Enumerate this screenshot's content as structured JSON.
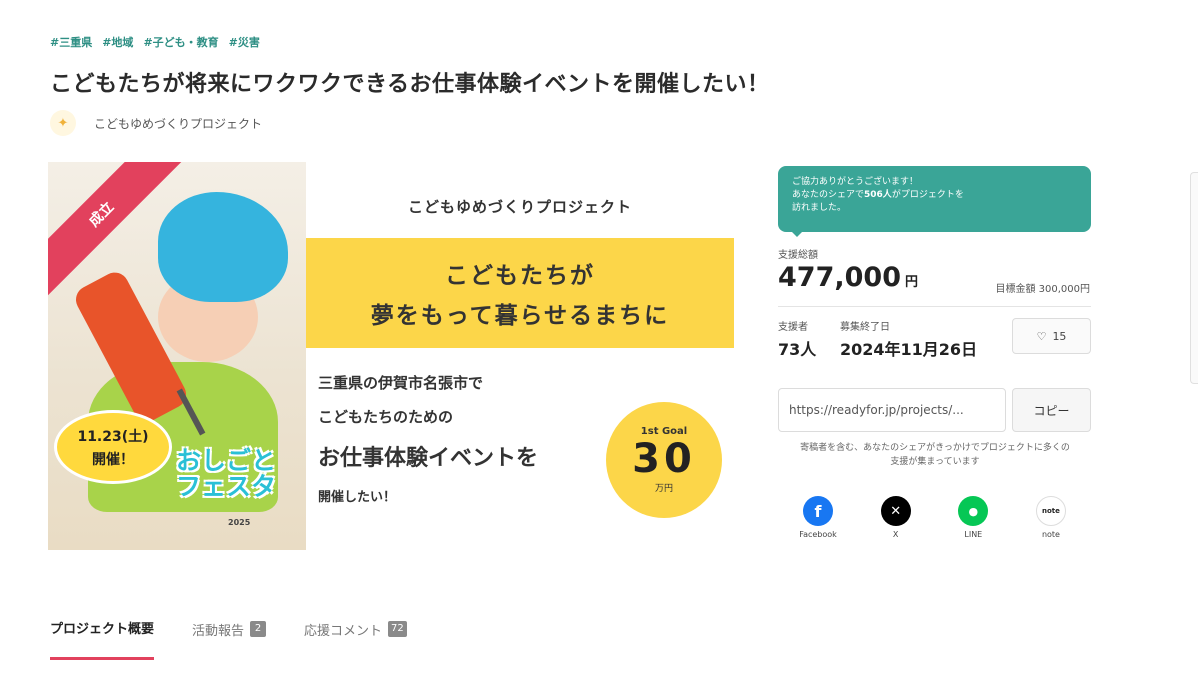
{
  "tags": [
    "#三重県",
    "#地域",
    "#子ども・教育",
    "#災害"
  ],
  "title": "こどもたちが将来にワクワクできるお仕事体験イベントを開催したい！",
  "owner": {
    "name": "こどもゆめづくりプロジェクト"
  },
  "hero": {
    "ribbon": "成立",
    "date_line1": "11.23(土)",
    "date_line2": "開催！",
    "logo_line1": "おしごと",
    "logo_line2": "フェスタ",
    "logo_year": "2025",
    "org": "こどもゆめづくりプロジェクト",
    "banner_line1": "こどもたちが",
    "banner_line2": "夢をもって暮らせるまちに",
    "text1": "三重県の伊賀市名張市で",
    "text2": "こどもたちのための",
    "text3": "お仕事体験イベントを",
    "text4": "開催したい！",
    "goal_label": "1st Goal",
    "goal_value": "30",
    "goal_unit": "万円"
  },
  "notice": {
    "line1": "ご協力ありがとうございます！",
    "line2_pre": "あなたのシェアで",
    "line2_bold": "506人",
    "line2_post": "がプロジェクトを",
    "line3": "訪れました。"
  },
  "funding": {
    "amount_label": "支援総額",
    "amount": "477,000",
    "amount_unit": "円",
    "target": "目標金額 300,000円",
    "supporters_label": "支援者",
    "supporters": "73人",
    "end_label": "募集終了日",
    "end_date": "2024年11月26日",
    "favorites": "15"
  },
  "share": {
    "url": "https://readyfor.jp/projects/...",
    "copy_label": "コピー",
    "note": "寄稿者を含む、あなたのシェアがきっかけでプロジェクトに多くの支援が集まっています",
    "items": [
      {
        "label": "Facebook",
        "icon": "facebook-icon",
        "color": "#1877f2",
        "glyph": "f"
      },
      {
        "label": "X",
        "icon": "x-icon",
        "color": "#000000",
        "glyph": "𝕏"
      },
      {
        "label": "LINE",
        "icon": "line-icon",
        "color": "#06c755",
        "glyph": "L"
      },
      {
        "label": "note",
        "icon": "note-icon",
        "color": "#ffffff",
        "glyph": "note"
      }
    ]
  },
  "tabs": [
    {
      "label": "プロジェクト概要",
      "count": null,
      "active": true
    },
    {
      "label": "活動報告",
      "count": "2",
      "active": false
    },
    {
      "label": "応援コメント",
      "count": "72",
      "active": false
    }
  ]
}
